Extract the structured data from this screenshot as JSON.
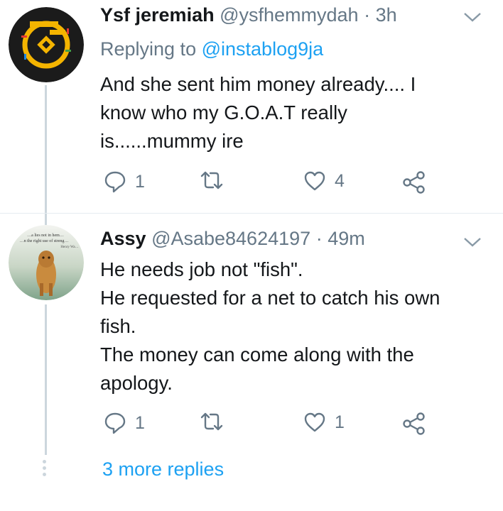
{
  "colors": {
    "accent": "#1da1f2",
    "secondary_text": "#657786",
    "primary_text": "#14171a",
    "thread_line": "#ccd6dd"
  },
  "tweets": [
    {
      "name": "Ysf jeremiah",
      "handle": "@ysfhemmydah",
      "separator": "·",
      "time": "3h",
      "replying_prefix": "Replying to",
      "replying_to": "@instablog9ja",
      "avatar_icon": "yellow-logo-avatar",
      "lines": [
        "And she sent him money already.... I",
        "know who my G.O.A.T really",
        "is......mummy ire"
      ],
      "reply_count": "1",
      "retweet_count": "",
      "like_count": "4"
    },
    {
      "name": "Assy",
      "handle": "@Asabe84624197",
      "separator": "·",
      "time": "49m",
      "avatar_icon": "lion-photo-avatar",
      "avatar_caption_lines": [
        "…a lies not in hem…",
        "…n the right use of streng…",
        "Henry Wa…"
      ],
      "lines": [
        "He needs job not \"fish\".",
        "He requested for a net to catch his own",
        "fish.",
        "The money can come along with the",
        "apology."
      ],
      "reply_count": "1",
      "retweet_count": "",
      "like_count": "1"
    }
  ],
  "more_replies": "3 more replies"
}
